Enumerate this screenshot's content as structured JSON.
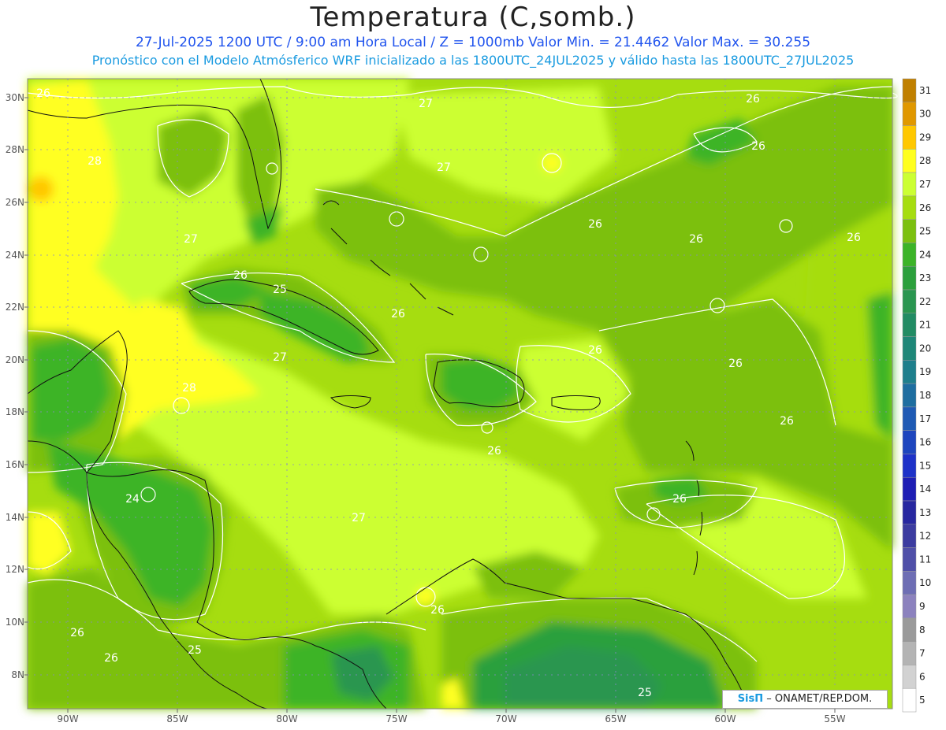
{
  "header": {
    "title": "Temperatura (C,somb.)",
    "line1": "27-Jul-2025  1200 UTC / 9:00 am Hora Local / Z = 1000mb   Valor Min. = 21.4462  Valor Max. = 30.255",
    "line2": "Pronóstico con el Modelo Atmósferico WRF inicializado a las 1800UTC_24JUL2025 y válido hasta las  1800UTC_27JUL2025"
  },
  "axes": {
    "lat_labels": [
      "30N",
      "28N",
      "26N",
      "24N",
      "22N",
      "20N",
      "18N",
      "16N",
      "14N",
      "12N",
      "10N",
      "8N"
    ],
    "lon_labels": [
      "90W",
      "85W",
      "80W",
      "75W",
      "70W",
      "65W",
      "60W",
      "55W"
    ]
  },
  "colorbar": {
    "levels": [
      "31",
      "30",
      "29",
      "28",
      "27",
      "26",
      "25",
      "24",
      "23",
      "22",
      "21",
      "20",
      "19",
      "18",
      "17",
      "16",
      "15",
      "14",
      "13",
      "12",
      "11",
      "10",
      "9",
      "8",
      "7",
      "6",
      "5"
    ],
    "colors": [
      "#c08000",
      "#e09800",
      "#ffc800",
      "#ffff20",
      "#ccff33",
      "#a6dd10",
      "#7cc010",
      "#3cb428",
      "#2ca03c",
      "#2a9650",
      "#228c64",
      "#1e8778",
      "#1e7f8c",
      "#1e6ea0",
      "#1e5ab4",
      "#1e46be",
      "#1e32c8",
      "#1e1eb4",
      "#2828a0",
      "#3c3ca0",
      "#5050a8",
      "#6e6eb4",
      "#8c82be",
      "#9a9a9a",
      "#b4b4b4",
      "#d2d2d2",
      "#ffffff"
    ]
  },
  "contour_labels": [
    "26",
    "27",
    "26",
    "26",
    "28",
    "27",
    "26",
    "26",
    "26",
    "26",
    "27",
    "25",
    "26",
    "26",
    "27",
    "26",
    "28",
    "26",
    "24",
    "26",
    "26",
    "27",
    "26",
    "26",
    "25",
    "26",
    "26",
    "26",
    "25"
  ],
  "credit": {
    "brand": "SisΠ",
    "text": "– ONAMET/REP.DOM."
  }
}
